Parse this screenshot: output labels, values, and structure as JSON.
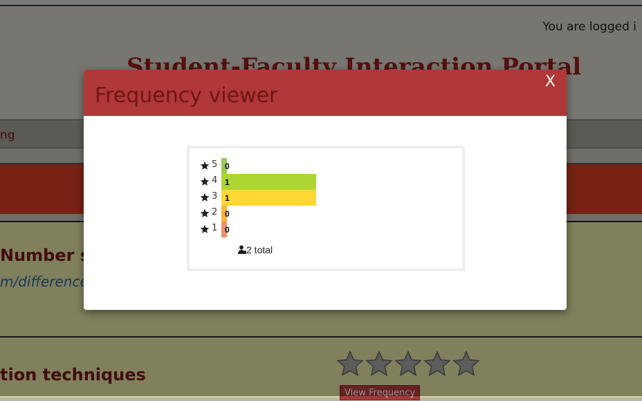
{
  "page": {
    "login_status": "You are logged i",
    "site_title": "Student-Faculty Interaction Portal",
    "nav_item": "ng",
    "course1": {
      "title": "Number sy",
      "link": "m/difference/"
    },
    "course2": {
      "title": "tion techniques",
      "button": "View Frequency",
      "star_rating": 0,
      "star_count": 5
    }
  },
  "modal": {
    "title": "Frequency viewer",
    "close_label": "X",
    "rows": [
      {
        "label": "5",
        "count": "0",
        "fraction": 0.0,
        "color": "#9cc85a"
      },
      {
        "label": "4",
        "count": "1",
        "fraction": 0.5,
        "color": "#add633"
      },
      {
        "label": "3",
        "count": "1",
        "fraction": 0.5,
        "color": "#ffd835"
      },
      {
        "label": "2",
        "count": "0",
        "fraction": 0.0,
        "color": "#ffb234"
      },
      {
        "label": "1",
        "count": "0",
        "fraction": 0.0,
        "color": "#f0906a"
      }
    ],
    "total_text": "2 total",
    "icons": {
      "row": "star-icon",
      "total": "user-icon"
    }
  },
  "colors": {
    "modal_header": "#b13838",
    "title_text": "#6e1515"
  }
}
